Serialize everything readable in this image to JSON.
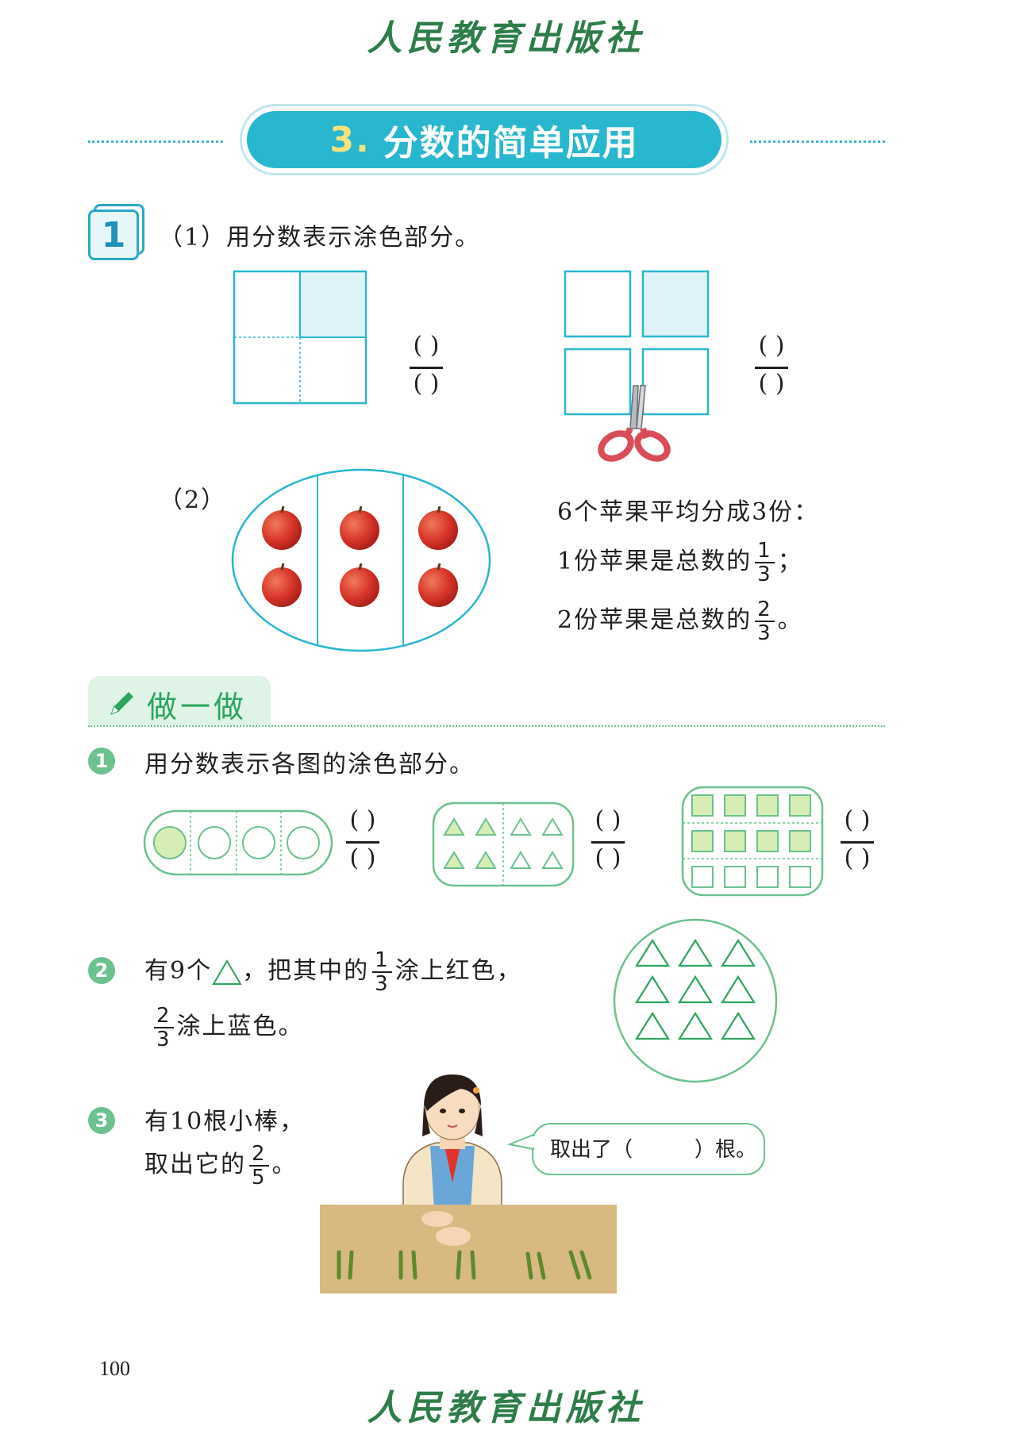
{
  "header": {
    "publisher": "人民教育出版社"
  },
  "footer": {
    "publisher": "人民教育出版社",
    "page_number": "100"
  },
  "section": {
    "number": "3.",
    "title": "分数的简单应用"
  },
  "example1": {
    "badge": "1",
    "part1_label": "（1）用分数表示涂色部分。",
    "part2_label": "（2）",
    "blank_numerator": "(   )",
    "blank_denominator": "(   )",
    "statement_line1": "6个苹果平均分成3份：",
    "statement_line2_prefix": "1份苹果是总数的",
    "statement_line2_num": "1",
    "statement_line2_den": "3",
    "statement_line2_suffix": "；",
    "statement_line3_prefix": "2份苹果是总数的",
    "statement_line3_num": "2",
    "statement_line3_den": "3",
    "statement_line3_suffix": "。"
  },
  "practice": {
    "heading": "做一做",
    "q1": {
      "number": "1",
      "text": "用分数表示各图的涂色部分。"
    },
    "q2": {
      "number": "2",
      "text_a": "有9个",
      "text_b": "，把其中的",
      "frac1_num": "1",
      "frac1_den": "3",
      "text_c": "涂上红色，",
      "frac2_num": "2",
      "frac2_den": "3",
      "text_d": "涂上蓝色。"
    },
    "q3": {
      "number": "3",
      "line1": "有10根小棒，",
      "line2_prefix": "取出它的",
      "frac_num": "2",
      "frac_den": "5",
      "line2_suffix": "。",
      "speech": "取出了（　　　）根。"
    }
  },
  "colors": {
    "teal": "#29b6cf",
    "shade_blue": "#dff2f8",
    "green_line": "#6cc18f",
    "green_fill": "#d6edb5",
    "apple_red": "#d8352a"
  }
}
